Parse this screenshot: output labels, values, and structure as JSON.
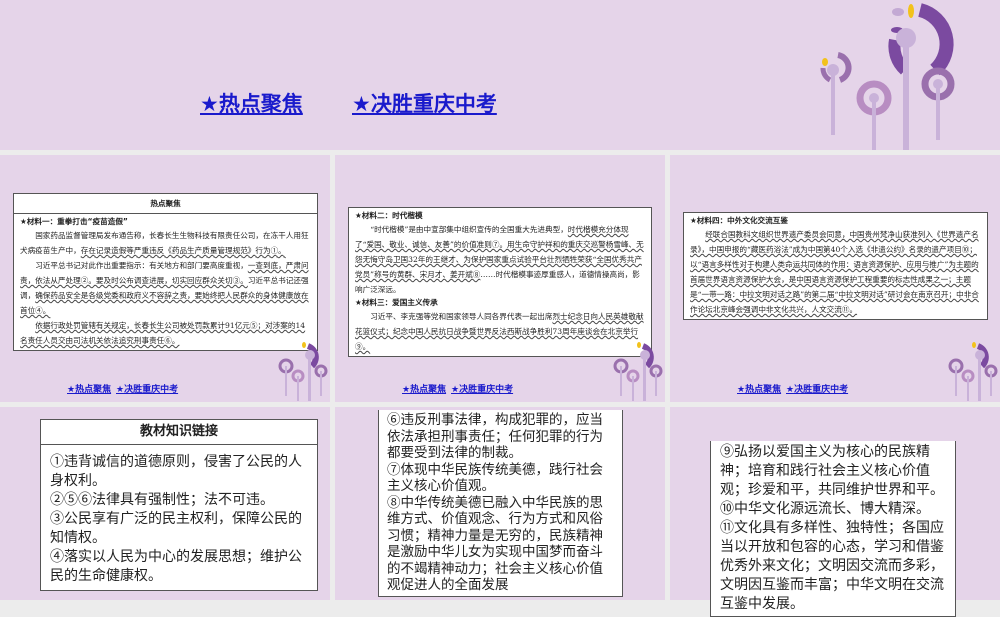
{
  "title_slide": {
    "link1": "★热点聚焦",
    "link2": "★决胜重庆中考"
  },
  "footer": {
    "link1": "★热点聚焦",
    "link2": "★决胜重庆中考"
  },
  "slide2": {
    "header": "热点聚焦",
    "m1_title": "★材料一：重拳打击“疫苗造假”",
    "p1a": "国家药品监督管理局发布通告称，长春长生生物科技有限责任公司，在冻干人用狂犬病疫苗生产中，",
    "p1b": "存在记录造假等严重违反《药品生产质量管理规范》行为①。",
    "p2a": "习近平总书记对此作出重要指示：有关地方和部门要高度重视，",
    "p2b": "一查到底，严肃问责，依法从严处理②。要及时公布调查进展，切实回应群众关切③。",
    "p2c": "习近平总书记还强调，",
    "p2d": "确保药品安全是各级党委和政府义不容辞之责，要始终把人民群众的身体健康放在首位④。",
    "p3a": "依据行政处罚管辖有关规定，长春长生公司被处罚款累计91亿元⑤；对涉案的14名责任人员交由司法机关依法追究刑事责任⑥。"
  },
  "slide3": {
    "m2_title": "★材料二：时代楷模",
    "p1a": "“时代楷模”是由中宣部集中组织宣传的全国重大先进典型，",
    "p1b": "时代楷模充分体现了“爱国、敬业、诚信、友善”的价值准则⑦。用生命守护祥和的重庆交巡警杨雪峰、无怨无悔守岛卫国32年的王继才、为保护国家重点试验平台壮烈牺牲荣获“全国优秀共产党员”称号的黄群、宋月才、姜开斌⑧",
    "p1c": "……时代楷模事迹厚重感人，道德情操高尚，影响广泛深远。",
    "m3_title": "★材料三：爱国主义传承",
    "p2a": "习近平、李克强等党和国家领导人同各界代表一起出席",
    "p2b": "烈士纪念日向人民英雄敬献花篮仪式；纪念中国人民抗日战争暨世界反法西斯战争胜利73周年座谈会在北京举行⑨。"
  },
  "slide4": {
    "m4_title": "★材料四：中外文化交流互鉴",
    "p1": "经联合国教科文组织世界遗产委员会同意，中国贵州梵净山获准列入《世界遗产名录》，中国申报的“藏医药浴法”成为中国第40个入选《非遗公约》名录的遗产项目⑩；以“语言多样性对于构建人类命运共同体的作用：语言资源保护、应用与推广”为主题的首届世界语言资源保护大会，是中国语言资源保护工程重要的标志性成果之一；主题是“一带一路：中拉文明对话之路”的第二届“中拉文明对话”研讨会在南京召开；中非合作论坛北京峰会强调中非文化共兴，人文交流⑪。"
  },
  "slide5": {
    "header": "教材知识链接",
    "items": [
      "①违背诚信的道德原则，侵害了公民的人身权利。",
      "②⑤⑥法律具有强制性；法不可违。",
      "③公民享有广泛的民主权利，保障公民的知情权。",
      "④落实以人民为中心的发展思想；维护公民的生命健康权。"
    ]
  },
  "slide6": {
    "items": [
      "⑥违反刑事法律，构成犯罪的，应当依法承担刑事责任；任何犯罪的行为都要受到法律的制裁。",
      "⑦体现中华民族传统美德，践行社会主义核心价值观。",
      "⑧中华传统美德已融入中华民族的思维方式、价值观念、行为方式和风俗习惯；精神力量是无穷的，民族精神是激励中华儿女为实现中国梦而奋斗的不竭精神动力；社会主义核心价值观促进人的全面发展"
    ]
  },
  "slide7": {
    "items": [
      "⑨弘扬以爱国主义为核心的民族精神；培育和践行社会主义核心价值观；珍爱和平，共同维护世界和平。",
      "⑩中华文化源远流长、博大精深。",
      "⑪文化具有多样性、独特性；各国应当以开放和包容的心态，学习和借鉴优秀外来文化；文明因交流而多彩，文明因互鉴而丰富；中华文明在交流互鉴中发展。"
    ]
  },
  "colors": {
    "background": "#e5d4e9",
    "link": "#1a1acc",
    "accent": "#7b4aa0",
    "leaf": "#f2c21b"
  }
}
